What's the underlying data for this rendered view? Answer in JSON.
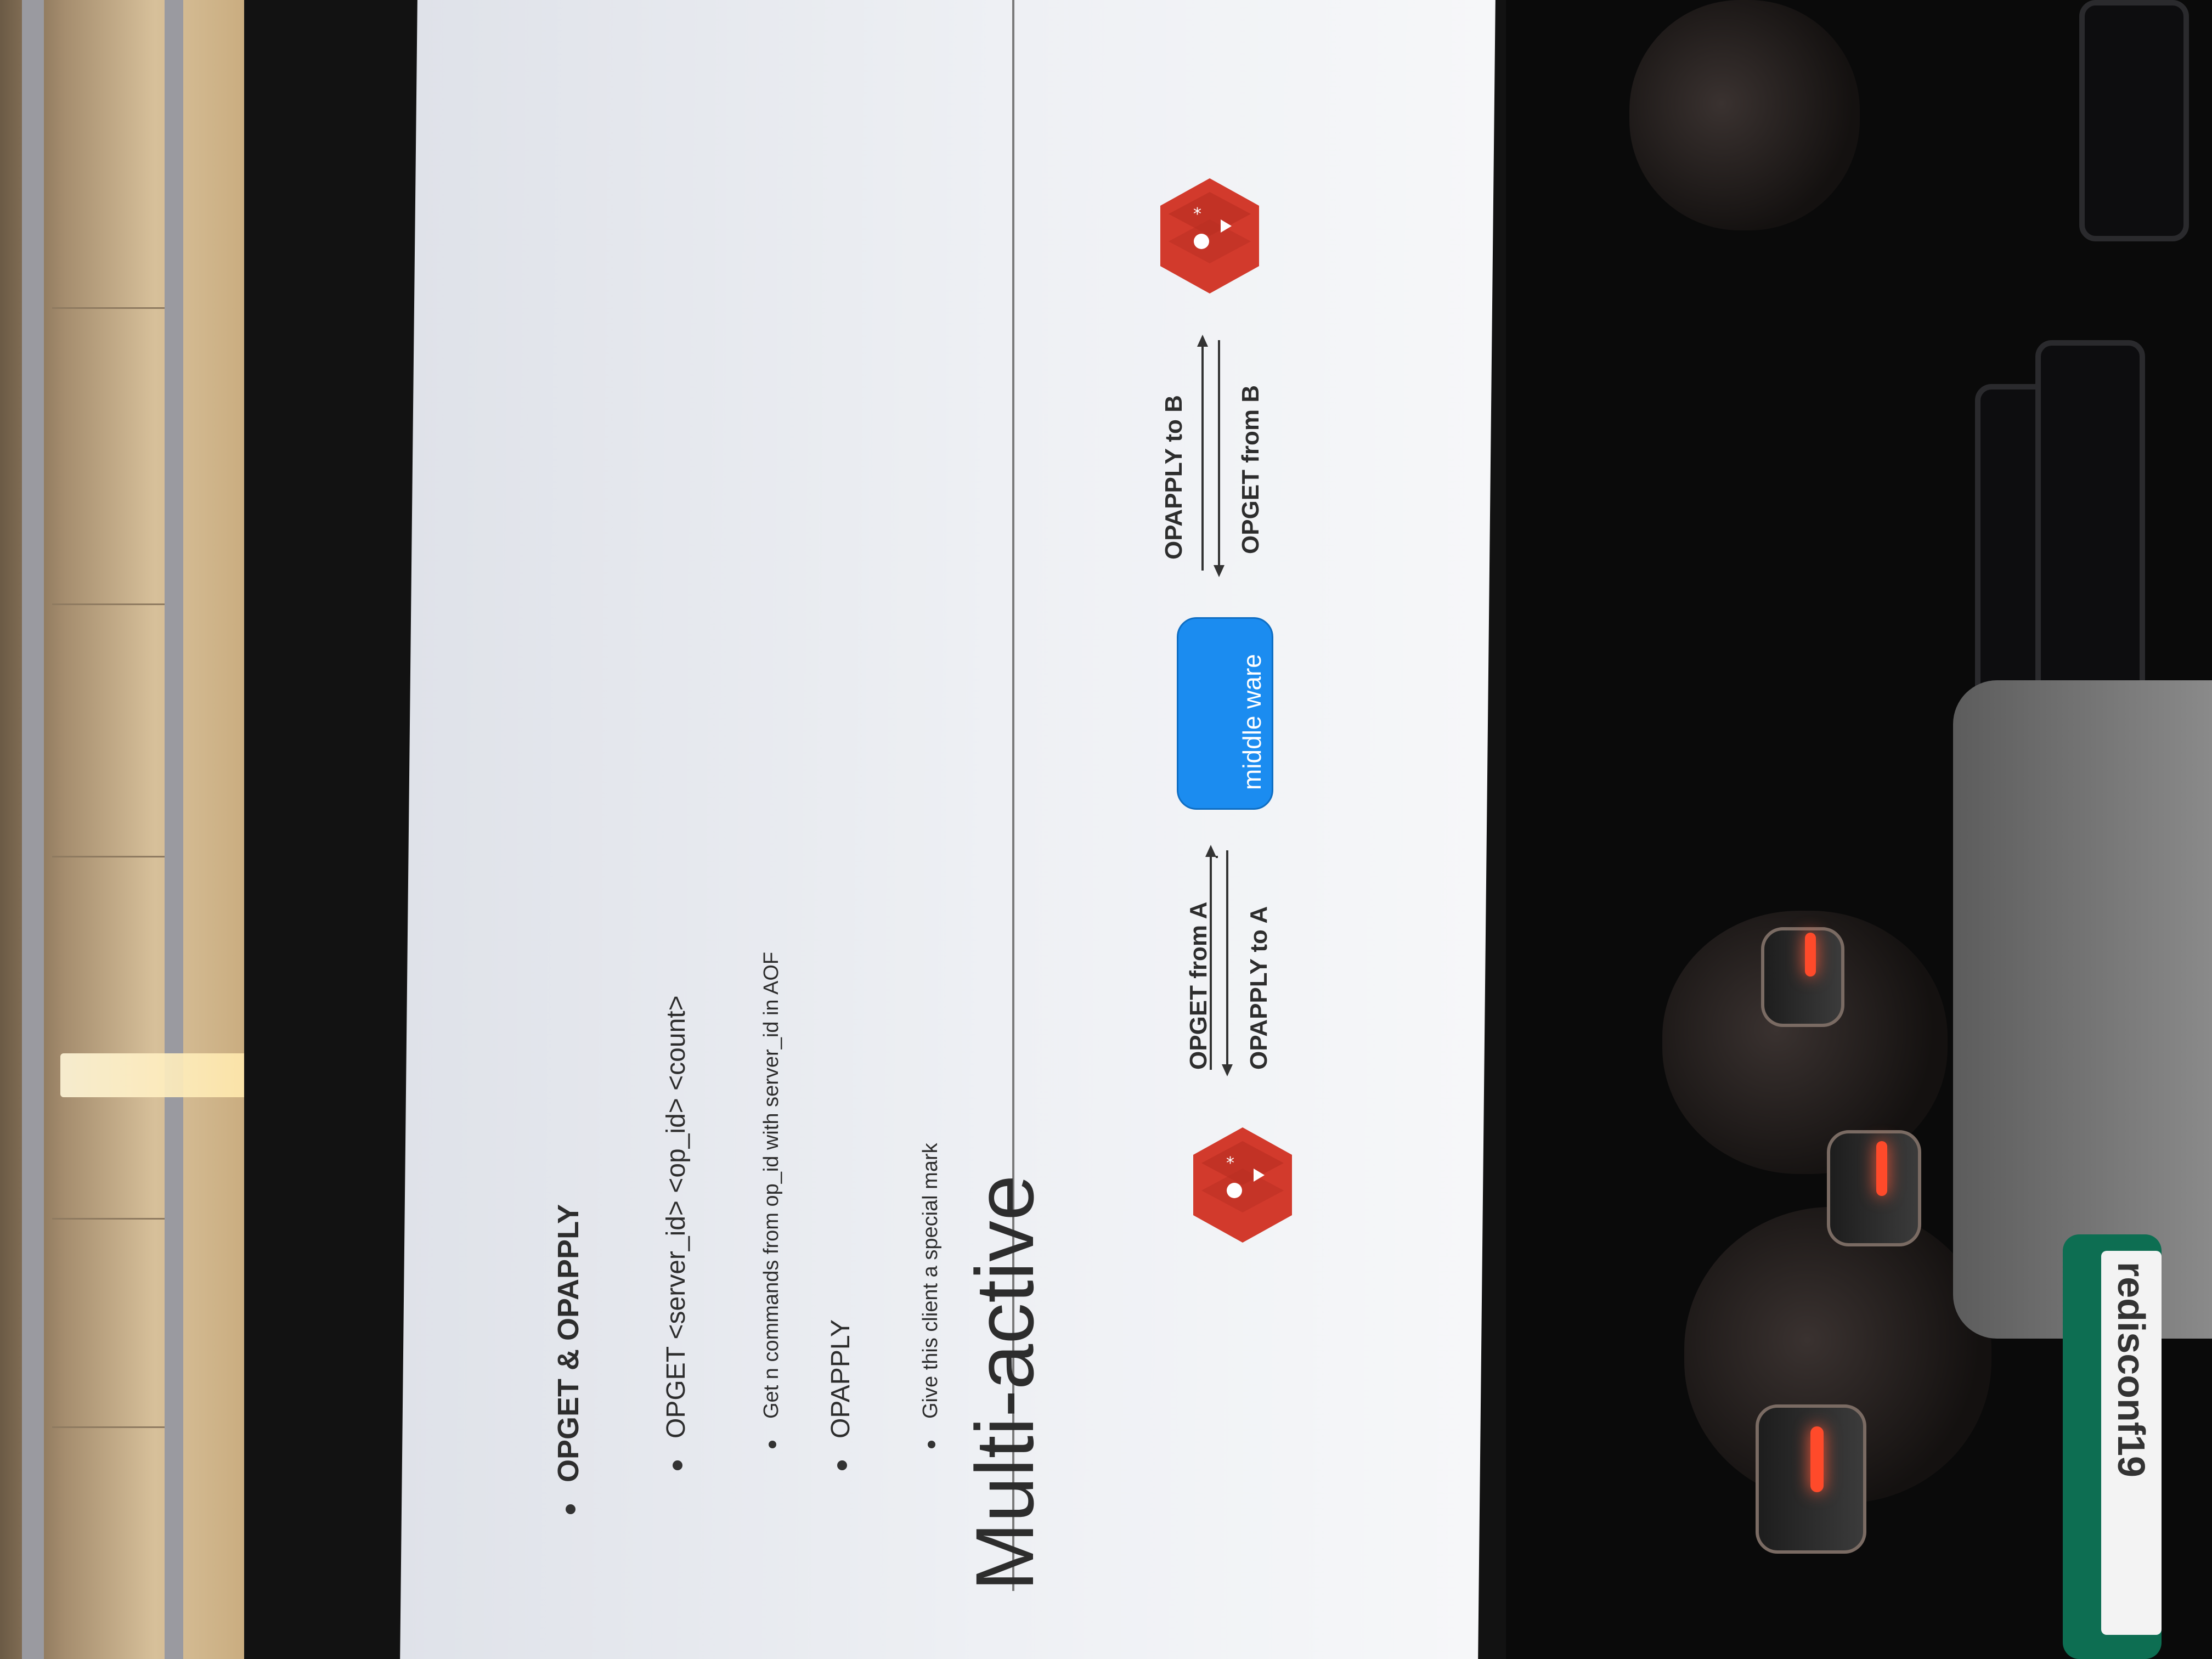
{
  "slide": {
    "title": "Multi-active",
    "bullets": [
      {
        "text": "OPGET & OPAPPLY",
        "level": 1
      },
      {
        "text": "OPGET <server_id> <op_id> <count>",
        "level": 2
      },
      {
        "text": "Get n commands from op_id with server_id in AOF",
        "level": 3
      },
      {
        "text": "OPAPPLY",
        "level": 2
      },
      {
        "text": "Give this client a special mark",
        "level": 3
      }
    ],
    "diagram": {
      "left_arrow_top": "OPGET from A",
      "left_arrow_bottom": "OPAPPLY to A",
      "middle_box": "middle ware",
      "right_arrow_top": "OPAPPLY to B",
      "right_arrow_bottom": "OPGET from B",
      "node_a_icon": "redis-icon",
      "node_b_icon": "redis-icon",
      "middle_box_color": "#1b8cf0",
      "redis_color": "#d23a2c"
    }
  },
  "badge": {
    "text": "redisconf19"
  }
}
